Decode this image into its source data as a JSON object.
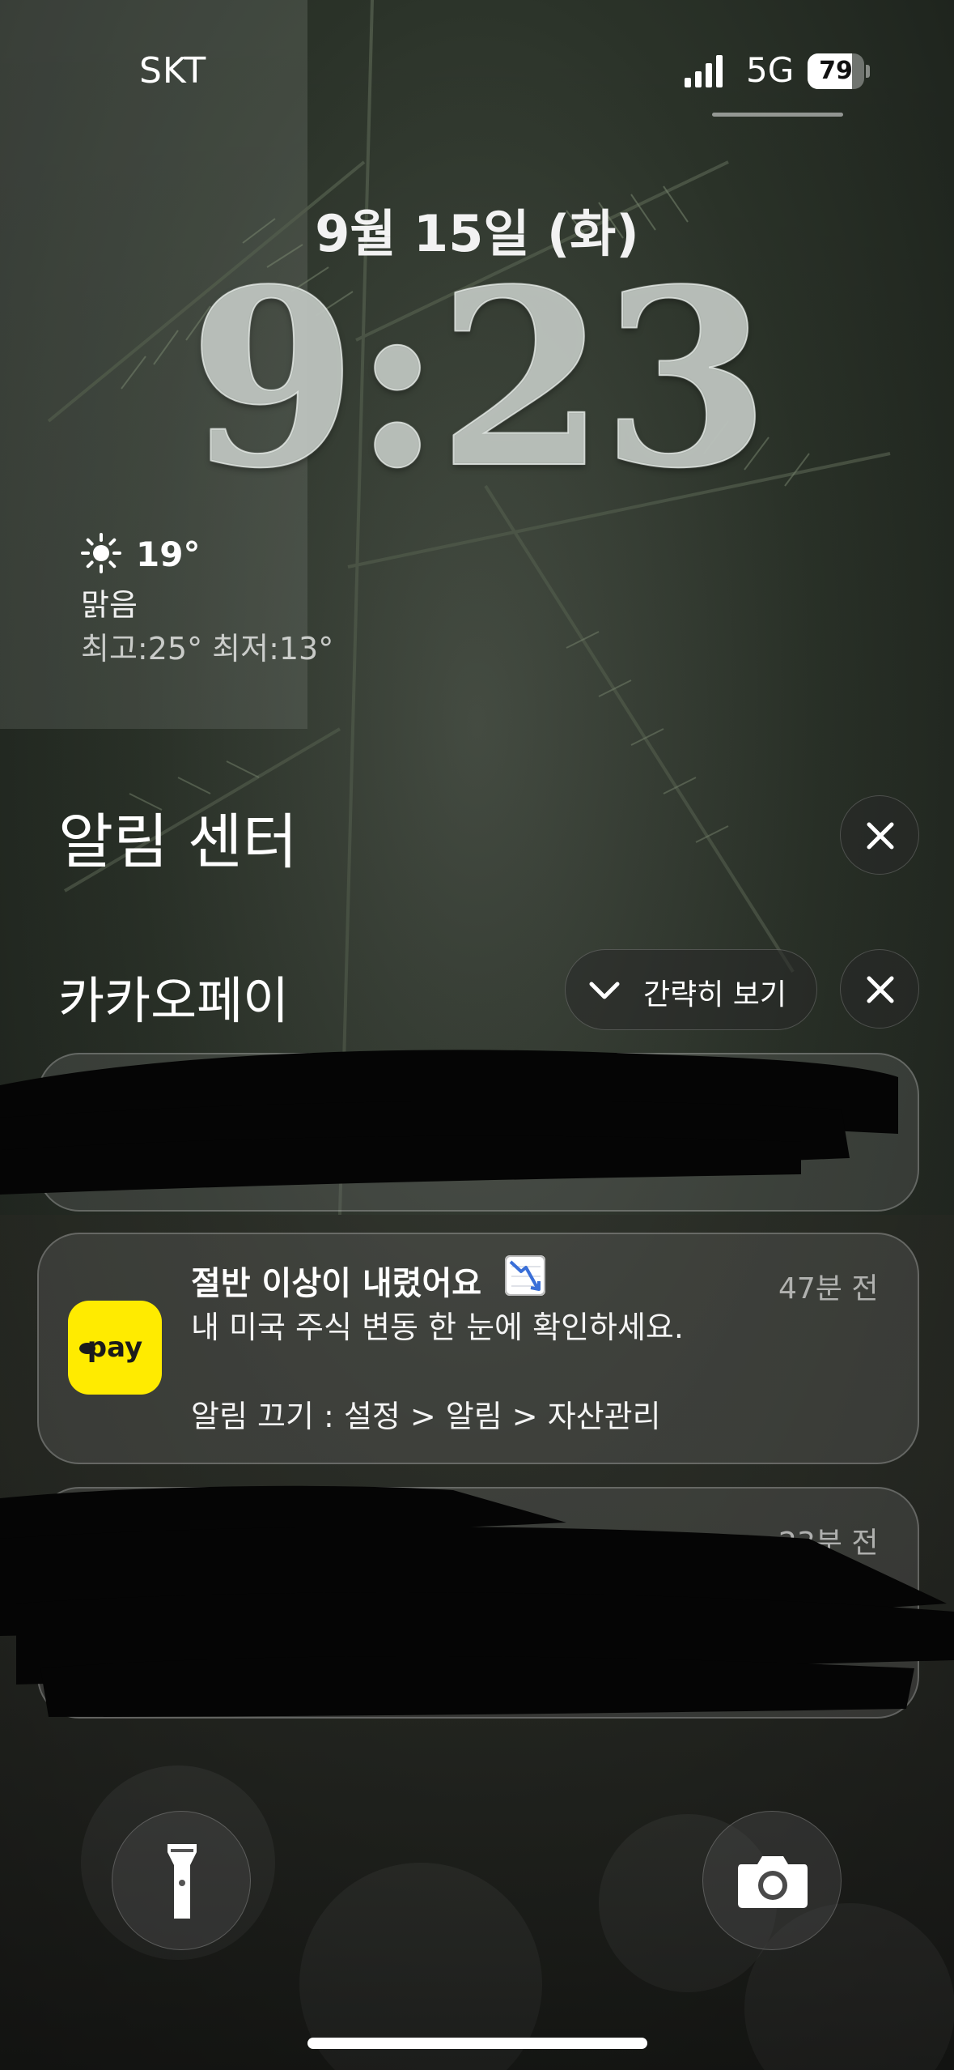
{
  "status_bar": {
    "carrier": "SKT",
    "network": "5G",
    "battery_percent": "79",
    "battery_level": 0.79
  },
  "lock_screen": {
    "date": "9월 15일 (화)",
    "time": "9:23"
  },
  "weather": {
    "icon": "sun-icon",
    "temperature": "19°",
    "condition": "맑음",
    "high_low": "최고:25° 최저:13°"
  },
  "notification_center": {
    "title": "알림 센터",
    "close_icon": "close-icon",
    "group": {
      "app_name": "카카오페이",
      "collapse_label": "간략히 보기",
      "collapse_icon": "chevron-down-icon",
      "close_icon": "close-icon"
    },
    "notifications": [
      {
        "redacted": true
      },
      {
        "app_icon_text": "pay",
        "title": "절반 이상이 내렸어요",
        "emoji_icon": "chart-decreasing-icon",
        "time": "47분 전",
        "body": "내 미국 주식 변동 한 눈에 확인하세요.",
        "footer": "알림 끄기 : 설정 > 알림 > 자산관리"
      },
      {
        "redacted": true,
        "time": "23분 전"
      }
    ]
  },
  "quick_actions": {
    "flashlight_icon": "flashlight-icon",
    "camera_icon": "camera-icon"
  },
  "colors": {
    "kakaopay_yellow": "#ffeb00",
    "chart_red": "#d93025",
    "chart_blue": "#3a6fd8"
  }
}
